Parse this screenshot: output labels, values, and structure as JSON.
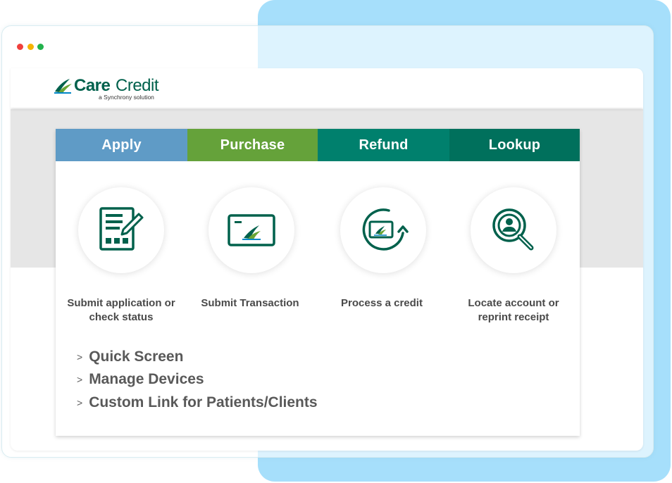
{
  "window": {
    "controls": [
      "close",
      "minimize",
      "maximize"
    ]
  },
  "logo": {
    "name_bold": "Care",
    "name_light": "Credit",
    "tagline": "a Synchrony solution"
  },
  "tabs": [
    {
      "label": "Apply",
      "color": "#5f9bc6"
    },
    {
      "label": "Purchase",
      "color": "#65a23a"
    },
    {
      "label": "Refund",
      "color": "#00806d"
    },
    {
      "label": "Lookup",
      "color": "#00705c"
    }
  ],
  "actions": [
    {
      "icon": "application-form-icon",
      "caption": "Submit application or check status"
    },
    {
      "icon": "credit-card-icon",
      "caption": "Submit Transaction"
    },
    {
      "icon": "card-refund-icon",
      "caption": "Process a credit"
    },
    {
      "icon": "account-search-icon",
      "caption": "Locate account or reprint receipt"
    }
  ],
  "links": [
    {
      "label": "Quick Screen"
    },
    {
      "label": "Manage Devices"
    },
    {
      "label": "Custom Link for Patients/Clients"
    }
  ],
  "colors": {
    "brand_dark_green": "#00614c",
    "background_panel": "#a6dffb",
    "dot_red": "#f0403c",
    "dot_yellow": "#f5b300",
    "dot_green": "#22b24c"
  }
}
